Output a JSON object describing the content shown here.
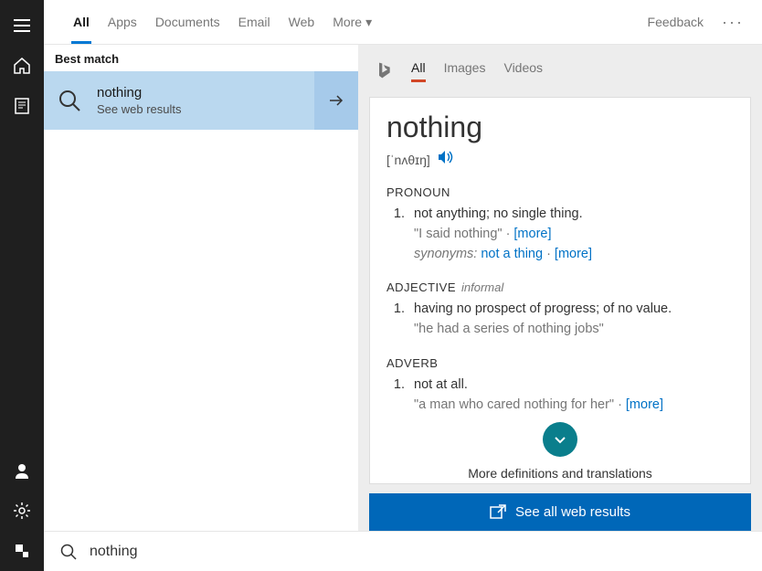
{
  "rail": {
    "items": [
      "menu",
      "home",
      "recent",
      "user",
      "settings",
      "share"
    ]
  },
  "tabs": {
    "items": [
      "All",
      "Apps",
      "Documents",
      "Email",
      "Web",
      "More"
    ],
    "active": 0,
    "feedback": "Feedback"
  },
  "left": {
    "best_match": "Best match",
    "result": {
      "title": "nothing",
      "subtitle": "See web results"
    }
  },
  "bing": {
    "tabs": [
      "All",
      "Images",
      "Videos"
    ],
    "active": 0
  },
  "dict": {
    "word": "nothing",
    "pron": "[ˈnʌθɪŋ]",
    "p1": {
      "pos": "PRONOUN",
      "num": "1.",
      "def": "not anything; no single thing.",
      "quote": "\"I said nothing\"",
      "more1": "[more]",
      "syn_label": "synonyms:",
      "syn": "not a thing",
      "more2": "[more]"
    },
    "p2": {
      "pos": "ADJECTIVE",
      "tag": "informal",
      "num": "1.",
      "def": "having no prospect of progress; of no value.",
      "quote": "\"he had a series of nothing jobs\""
    },
    "p3": {
      "pos": "ADVERB",
      "num": "1.",
      "def": "not at all.",
      "quote": "\"a man who cared nothing for her\"",
      "more": "[more]"
    },
    "expand": "More definitions and translations"
  },
  "see_all": "See all web results",
  "search": {
    "value": "nothing"
  }
}
